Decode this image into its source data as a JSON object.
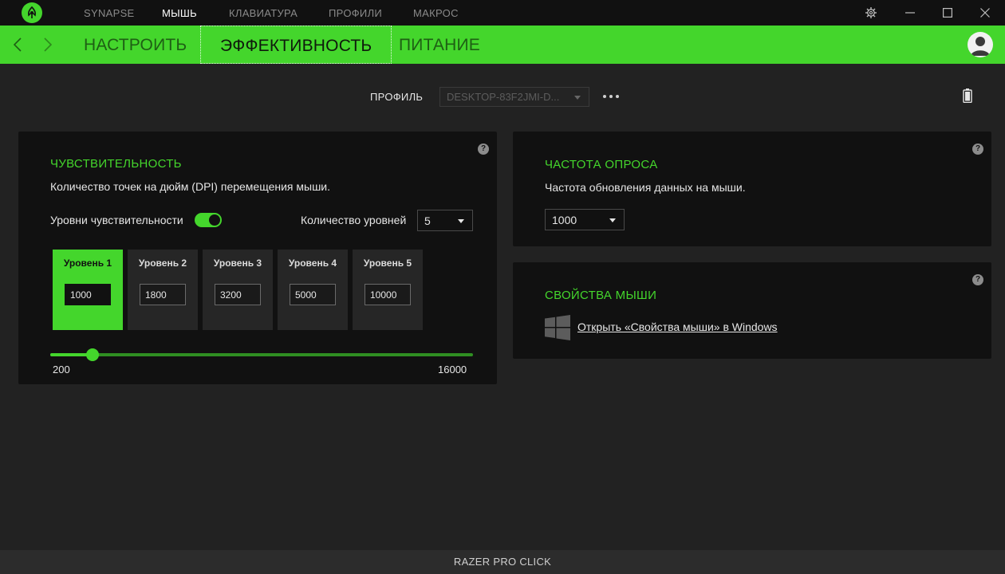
{
  "topnav": {
    "items": [
      "SYNAPSE",
      "МЫШЬ",
      "КЛАВИАТУРА",
      "ПРОФИЛИ",
      "МАКРОС"
    ],
    "active_index": 1
  },
  "subnav": {
    "tabs": [
      "НАСТРОИТЬ",
      "ЭФФЕКТИВНОСТЬ",
      "ПИТАНИЕ"
    ],
    "active_index": 1
  },
  "profile": {
    "label": "ПРОФИЛЬ",
    "selected": "DESKTOP-83F2JMI-D..."
  },
  "sensitivity": {
    "title": "ЧУВСТВИТЕЛЬНОСТЬ",
    "description": "Количество точек на дюйм (DPI) перемещения мыши.",
    "stages_label": "Уровни чувствительности",
    "stages_enabled": true,
    "count_label": "Количество уровней",
    "count_value": "5",
    "stages": [
      {
        "label": "Уровень 1",
        "value": "1000",
        "active": true
      },
      {
        "label": "Уровень 2",
        "value": "1800",
        "active": false
      },
      {
        "label": "Уровень 3",
        "value": "3200",
        "active": false
      },
      {
        "label": "Уровень 4",
        "value": "5000",
        "active": false
      },
      {
        "label": "Уровень 5",
        "value": "10000",
        "active": false
      }
    ],
    "slider": {
      "min": "200",
      "max": "16000",
      "value": 1000
    }
  },
  "polling": {
    "title": "ЧАСТОТА ОПРОСА",
    "description": "Частота обновления данных на мыши.",
    "value": "1000"
  },
  "mouse_props": {
    "title": "СВОЙСТВА МЫШИ",
    "link": "Открыть «Свойства мыши» в Windows"
  },
  "footer": {
    "device": "RAZER PRO CLICK"
  },
  "colors": {
    "accent": "#44d62c",
    "background": "#222222",
    "card": "#111111"
  }
}
